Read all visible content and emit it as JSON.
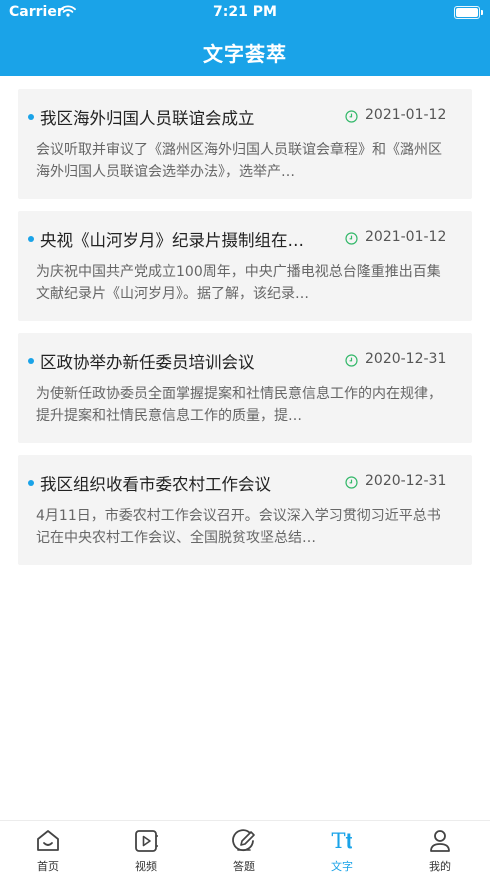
{
  "status_bar": {
    "carrier": "Carrier",
    "time": "7:21 PM"
  },
  "header": {
    "title": "文字荟萃"
  },
  "articles": [
    {
      "title": "我区海外归国人员联谊会成立",
      "date": "2021-01-12",
      "summary": "会议听取并审议了《潞州区海外归国人员联谊会章程》和《潞州区海外归国人员联谊会选举办法》，选举产…"
    },
    {
      "title": "央视《山河岁月》纪录片摄制组在…",
      "date": "2021-01-12",
      "summary": "为庆祝中国共产党成立100周年，中央广播电视总台隆重推出百集文献纪录片《山河岁月》。据了解，该纪录…"
    },
    {
      "title": "区政协举办新任委员培训会议",
      "date": "2020-12-31",
      "summary": "为使新任政协委员全面掌握提案和社情民意信息工作的内在规律，提升提案和社情民意信息工作的质量，提…"
    },
    {
      "title": "我区组织收看市委农村工作会议",
      "date": "2020-12-31",
      "summary": "4月11日，市委农村工作会议召开。会议深入学习贯彻习近平总书记在中央农村工作会议、全国脱贫攻坚总结…"
    }
  ],
  "tabbar": {
    "items": [
      {
        "label": "首页",
        "icon": "home-icon"
      },
      {
        "label": "视频",
        "icon": "video-icon"
      },
      {
        "label": "答题",
        "icon": "edit-icon"
      },
      {
        "label": "文字",
        "icon": "text-icon",
        "active": true
      },
      {
        "label": "我的",
        "icon": "user-icon"
      }
    ],
    "active_color": "#1aa3e8"
  },
  "colors": {
    "accent": "#1aa3e8",
    "card_bg": "#f4f4f4",
    "date_icon": "#34b86a"
  }
}
